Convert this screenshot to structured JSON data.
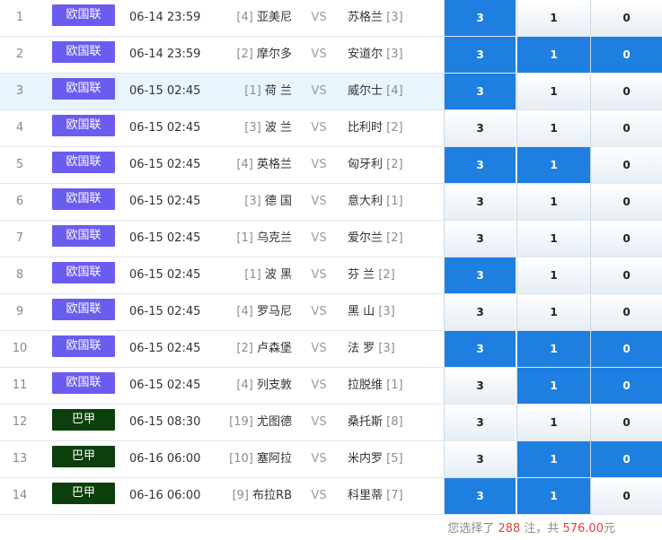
{
  "colors": {
    "league_european": "#6b5cf0",
    "league_brazil": "#0b3f0b",
    "selected": "#1f7fe0"
  },
  "vs_label": "VS",
  "matches": [
    {
      "num": "1",
      "league": "欧国联",
      "league_type": "eu",
      "time": "06-14 23:59",
      "home_rank": "[4]",
      "home": "亚美尼",
      "away": "苏格兰",
      "away_rank": "[3]",
      "options": [
        "3",
        "1",
        "0"
      ],
      "selected": [
        true,
        false,
        false
      ]
    },
    {
      "num": "2",
      "league": "欧国联",
      "league_type": "eu",
      "time": "06-14 23:59",
      "home_rank": "[2]",
      "home": "摩尔多",
      "away": "安道尔",
      "away_rank": "[3]",
      "options": [
        "3",
        "1",
        "0"
      ],
      "selected": [
        true,
        true,
        true
      ]
    },
    {
      "num": "3",
      "league": "欧国联",
      "league_type": "eu",
      "time": "06-15 02:45",
      "home_rank": "[1]",
      "home": "荷 兰",
      "away": "威尔士",
      "away_rank": "[4]",
      "options": [
        "3",
        "1",
        "0"
      ],
      "selected": [
        true,
        false,
        false
      ]
    },
    {
      "num": "4",
      "league": "欧国联",
      "league_type": "eu",
      "time": "06-15 02:45",
      "home_rank": "[3]",
      "home": "波 兰",
      "away": "比利时",
      "away_rank": "[2]",
      "options": [
        "3",
        "1",
        "0"
      ],
      "selected": [
        false,
        false,
        false
      ]
    },
    {
      "num": "5",
      "league": "欧国联",
      "league_type": "eu",
      "time": "06-15 02:45",
      "home_rank": "[4]",
      "home": "英格兰",
      "away": "匈牙利",
      "away_rank": "[2]",
      "options": [
        "3",
        "1",
        "0"
      ],
      "selected": [
        true,
        true,
        false
      ]
    },
    {
      "num": "6",
      "league": "欧国联",
      "league_type": "eu",
      "time": "06-15 02:45",
      "home_rank": "[3]",
      "home": "德 国",
      "away": "意大利",
      "away_rank": "[1]",
      "options": [
        "3",
        "1",
        "0"
      ],
      "selected": [
        false,
        false,
        false
      ]
    },
    {
      "num": "7",
      "league": "欧国联",
      "league_type": "eu",
      "time": "06-15 02:45",
      "home_rank": "[1]",
      "home": "乌克兰",
      "away": "爱尔兰",
      "away_rank": "[2]",
      "options": [
        "3",
        "1",
        "0"
      ],
      "selected": [
        false,
        false,
        false
      ]
    },
    {
      "num": "8",
      "league": "欧国联",
      "league_type": "eu",
      "time": "06-15 02:45",
      "home_rank": "[1]",
      "home": "波 黑",
      "away": "芬 兰",
      "away_rank": "[2]",
      "options": [
        "3",
        "1",
        "0"
      ],
      "selected": [
        true,
        false,
        false
      ]
    },
    {
      "num": "9",
      "league": "欧国联",
      "league_type": "eu",
      "time": "06-15 02:45",
      "home_rank": "[4]",
      "home": "罗马尼",
      "away": "黑 山",
      "away_rank": "[3]",
      "options": [
        "3",
        "1",
        "0"
      ],
      "selected": [
        false,
        false,
        false
      ]
    },
    {
      "num": "10",
      "league": "欧国联",
      "league_type": "eu",
      "time": "06-15 02:45",
      "home_rank": "[2]",
      "home": "卢森堡",
      "away": "法 罗",
      "away_rank": "[3]",
      "options": [
        "3",
        "1",
        "0"
      ],
      "selected": [
        true,
        true,
        true
      ]
    },
    {
      "num": "11",
      "league": "欧国联",
      "league_type": "eu",
      "time": "06-15 02:45",
      "home_rank": "[4]",
      "home": "列支敦",
      "away": "拉脱维",
      "away_rank": "[1]",
      "options": [
        "3",
        "1",
        "0"
      ],
      "selected": [
        false,
        true,
        true
      ]
    },
    {
      "num": "12",
      "league": "巴甲",
      "league_type": "br",
      "time": "06-15 08:30",
      "home_rank": "[19]",
      "home": "尤图德",
      "away": "桑托斯",
      "away_rank": "[8]",
      "options": [
        "3",
        "1",
        "0"
      ],
      "selected": [
        false,
        false,
        false
      ]
    },
    {
      "num": "13",
      "league": "巴甲",
      "league_type": "br",
      "time": "06-16 06:00",
      "home_rank": "[10]",
      "home": "塞阿拉",
      "away": "米内罗",
      "away_rank": "[5]",
      "options": [
        "3",
        "1",
        "0"
      ],
      "selected": [
        false,
        true,
        true
      ]
    },
    {
      "num": "14",
      "league": "巴甲",
      "league_type": "br",
      "time": "06-16 06:00",
      "home_rank": "[9]",
      "home": "布拉RB",
      "away": "科里蒂",
      "away_rank": "[7]",
      "options": [
        "3",
        "1",
        "0"
      ],
      "selected": [
        true,
        true,
        false
      ]
    }
  ],
  "footer": {
    "prefix": "您选择了",
    "count": "288",
    "middle": "注，共",
    "amount": "576.00",
    "suffix": "元"
  }
}
